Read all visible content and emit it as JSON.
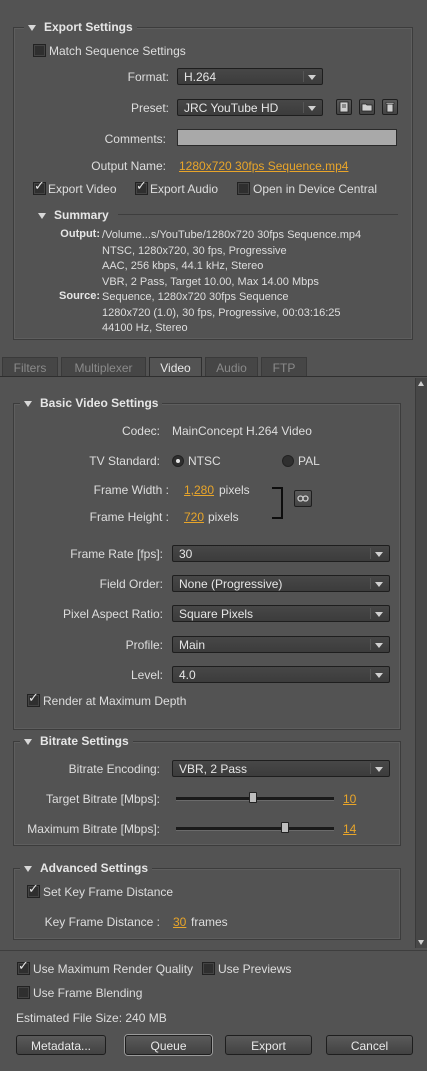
{
  "export_settings": {
    "title": "Export Settings",
    "match_sequence": {
      "label": "Match Sequence Settings",
      "checked": false
    },
    "format": {
      "label": "Format:",
      "value": "H.264"
    },
    "preset": {
      "label": "Preset:",
      "value": "JRC YouTube HD"
    },
    "comments": {
      "label": "Comments:",
      "value": ""
    },
    "output_name": {
      "label": "Output Name:",
      "value": "1280x720 30fps Sequence.mp4"
    },
    "export_video": {
      "label": "Export Video",
      "checked": true
    },
    "export_audio": {
      "label": "Export Audio",
      "checked": true
    },
    "open_device_central": {
      "label": "Open in Device Central",
      "checked": false
    },
    "summary": {
      "title": "Summary",
      "output_label": "Output:",
      "output_lines": [
        "/Volume...s/YouTube/1280x720 30fps Sequence.mp4",
        "NTSC, 1280x720, 30 fps, Progressive",
        "AAC, 256 kbps, 44.1 kHz, Stereo",
        "VBR, 2 Pass, Target 10.00, Max 14.00 Mbps"
      ],
      "source_label": "Source:",
      "source_lines": [
        "Sequence, 1280x720 30fps Sequence",
        "1280x720 (1.0), 30 fps, Progressive, 00:03:16:25",
        "44100 Hz, Stereo"
      ]
    }
  },
  "tabs": [
    {
      "label": "Filters",
      "active": false
    },
    {
      "label": "Multiplexer",
      "active": false
    },
    {
      "label": "Video",
      "active": true
    },
    {
      "label": "Audio",
      "active": false
    },
    {
      "label": "FTP",
      "active": false
    }
  ],
  "basic_video": {
    "title": "Basic Video Settings",
    "codec_label": "Codec:",
    "codec_value": "MainConcept H.264 Video",
    "tv_standard_label": "TV Standard:",
    "ntsc_label": "NTSC",
    "pal_label": "PAL",
    "frame_width_label": "Frame Width :",
    "frame_width_value": "1,280",
    "frame_height_label": "Frame Height :",
    "frame_height_value": "720",
    "pixels_unit": "pixels",
    "frame_rate": {
      "label": "Frame Rate [fps]:",
      "value": "30"
    },
    "field_order": {
      "label": "Field Order:",
      "value": "None (Progressive)"
    },
    "pixel_aspect": {
      "label": "Pixel Aspect Ratio:",
      "value": "Square Pixels"
    },
    "profile": {
      "label": "Profile:",
      "value": "Main"
    },
    "level": {
      "label": "Level:",
      "value": "4.0"
    },
    "render_max_depth": {
      "label": "Render at Maximum Depth",
      "checked": true
    }
  },
  "bitrate": {
    "title": "Bitrate Settings",
    "encoding": {
      "label": "Bitrate Encoding:",
      "value": "VBR, 2 Pass"
    },
    "target": {
      "label": "Target Bitrate [Mbps]:",
      "value": "10",
      "fraction": 0.49
    },
    "maximum": {
      "label": "Maximum Bitrate [Mbps]:",
      "value": "14",
      "fraction": 0.69
    }
  },
  "advanced": {
    "title": "Advanced Settings",
    "set_key_frame": {
      "label": "Set Key Frame Distance",
      "checked": true
    },
    "key_frame_label": "Key Frame Distance :",
    "key_frame_value": "30",
    "key_frame_unit": "frames"
  },
  "bottom": {
    "use_max_render": {
      "label": "Use Maximum Render Quality",
      "checked": true
    },
    "use_previews": {
      "label": "Use Previews",
      "checked": false
    },
    "use_frame_blending": {
      "label": "Use Frame Blending",
      "checked": false
    },
    "estimated_size": "Estimated File Size:  240 MB",
    "buttons": {
      "metadata": "Metadata...",
      "queue": "Queue",
      "export": "Export",
      "cancel": "Cancel"
    }
  }
}
